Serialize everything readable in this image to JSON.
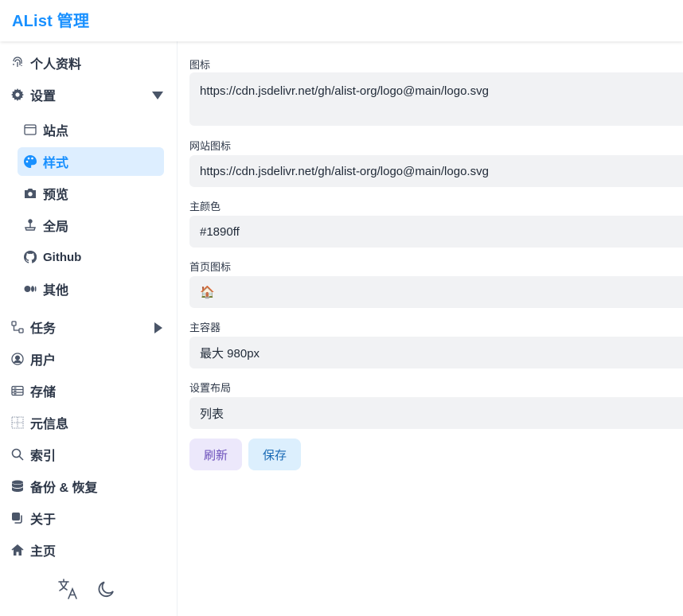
{
  "header": {
    "title": "AList 管理"
  },
  "sidebar": {
    "items": [
      {
        "label": "个人资料",
        "icon": "fingerprint-icon"
      },
      {
        "label": "设置",
        "icon": "gear-icon"
      },
      {
        "label": "站点",
        "icon": "browser-window-icon"
      },
      {
        "label": "样式",
        "icon": "palette-icon"
      },
      {
        "label": "预览",
        "icon": "camera-icon"
      },
      {
        "label": "全局",
        "icon": "joystick-icon"
      },
      {
        "label": "Github",
        "icon": "github-icon"
      },
      {
        "label": "其他",
        "icon": "medium-icon"
      },
      {
        "label": "任务",
        "icon": "workflow-icon"
      },
      {
        "label": "用户",
        "icon": "user-circle-icon"
      },
      {
        "label": "存储",
        "icon": "storage-icon"
      },
      {
        "label": "元信息",
        "icon": "metadata-icon"
      },
      {
        "label": "索引",
        "icon": "search-icon"
      },
      {
        "label": "备份 & 恢复",
        "icon": "database-icon"
      },
      {
        "label": "关于",
        "icon": "copy-icon"
      },
      {
        "label": "主页",
        "icon": "home-icon"
      }
    ],
    "footer": {
      "language_icon": "translate-icon",
      "theme_icon": "moon-icon"
    }
  },
  "form": {
    "logo_label": "图标",
    "logo_value": "https://cdn.jsdelivr.net/gh/alist-org/logo@main/logo.svg",
    "favicon_label": "网站图标",
    "favicon_value": "https://cdn.jsdelivr.net/gh/alist-org/logo@main/logo.svg",
    "main_color_label": "主颜色",
    "main_color_value": "#1890ff",
    "home_icon_label": "首页图标",
    "home_icon_value": "🏠",
    "container_label": "主容器",
    "container_value": "最大 980px",
    "layout_label": "设置布局",
    "layout_value": "列表"
  },
  "actions": {
    "refresh_label": "刷新",
    "save_label": "保存"
  },
  "colors": {
    "accent": "#1890ff",
    "active_bg": "#ddeeff",
    "field_bg": "#f1f2f4"
  }
}
